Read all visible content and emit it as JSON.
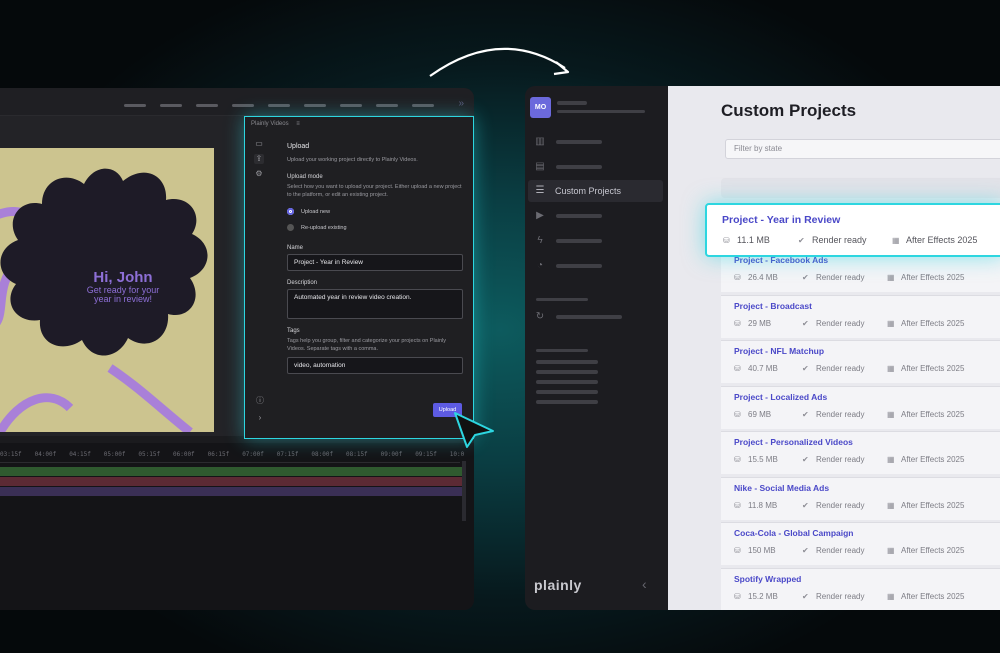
{
  "editor": {
    "canvas": {
      "greeting": "Hi, John",
      "subline1": "Get ready for your",
      "subline2": "year in review!"
    },
    "timeline_ticks": [
      "03:15f",
      "04:00f",
      "04:15f",
      "05:00f",
      "05:15f",
      "06:00f",
      "06:15f",
      "07:00f",
      "07:15f",
      "08:00f",
      "08:15f",
      "09:00f",
      "09:15f",
      "10:0"
    ],
    "panel": {
      "title": "Plainly Videos",
      "heading": "Upload",
      "description": "Upload your working project directly to Plainly Videos.",
      "mode_label": "Upload mode",
      "mode_help": "Select how you want to upload your project. Either upload a new project to the platform, or edit an existing project.",
      "mode_options": [
        "Upload new",
        "Re-upload existing"
      ],
      "mode_selected": "Upload new",
      "name_label": "Name",
      "name_value": "Project - Year in Review",
      "desc_label": "Description",
      "desc_value": "Automated year in review video creation.",
      "tags_label": "Tags",
      "tags_help": "Tags help you group, filter and categorize your projects on Plainly Videos. Separate tags with a comma.",
      "tags_value": "video, automation",
      "upload_button": "Upload"
    }
  },
  "app": {
    "avatar": "MO",
    "active_nav": "Custom Projects",
    "brand": "plainly",
    "page_title": "Custom Projects",
    "filter_placeholder": "Filter by state",
    "highlighted": {
      "name": "Project - Year in Review",
      "size": "11.1 MB",
      "status": "Render ready",
      "app": "After Effects 2025"
    },
    "projects": [
      {
        "name": "Project - Facebook Ads",
        "size": "26.4 MB",
        "status": "Render ready",
        "app": "After Effects 2025"
      },
      {
        "name": "Project - Broadcast",
        "size": "29 MB",
        "status": "Render ready",
        "app": "After Effects 2025"
      },
      {
        "name": "Project - NFL Matchup",
        "size": "40.7 MB",
        "status": "Render ready",
        "app": "After Effects 2025"
      },
      {
        "name": "Project - Localized Ads",
        "size": "69 MB",
        "status": "Render ready",
        "app": "After Effects 2025"
      },
      {
        "name": "Project - Personalized Videos",
        "size": "15.5 MB",
        "status": "Render ready",
        "app": "After Effects 2025"
      },
      {
        "name": "Nike - Social Media Ads",
        "size": "11.8 MB",
        "status": "Render ready",
        "app": "After Effects 2025"
      },
      {
        "name": "Coca-Cola - Global Campaign",
        "size": "150 MB",
        "status": "Render ready",
        "app": "After Effects 2025"
      },
      {
        "name": "Spotify Wrapped",
        "size": "15.2 MB",
        "status": "Render ready",
        "app": "After Effects 2025"
      }
    ]
  },
  "colors": {
    "accent": "#5d5be3",
    "highlight_glow": "#2dd6e0",
    "link": "#4a48c8"
  },
  "icons": [
    "folder-icon",
    "upload-icon",
    "gear-icon",
    "info-icon",
    "chevron-right-icon",
    "database-icon",
    "check-circle-icon",
    "after-effects-icon",
    "chart-icon",
    "film-icon",
    "list-icon",
    "video-icon",
    "bolt-icon",
    "palette-icon",
    "refresh-icon",
    "chevron-left-icon"
  ]
}
